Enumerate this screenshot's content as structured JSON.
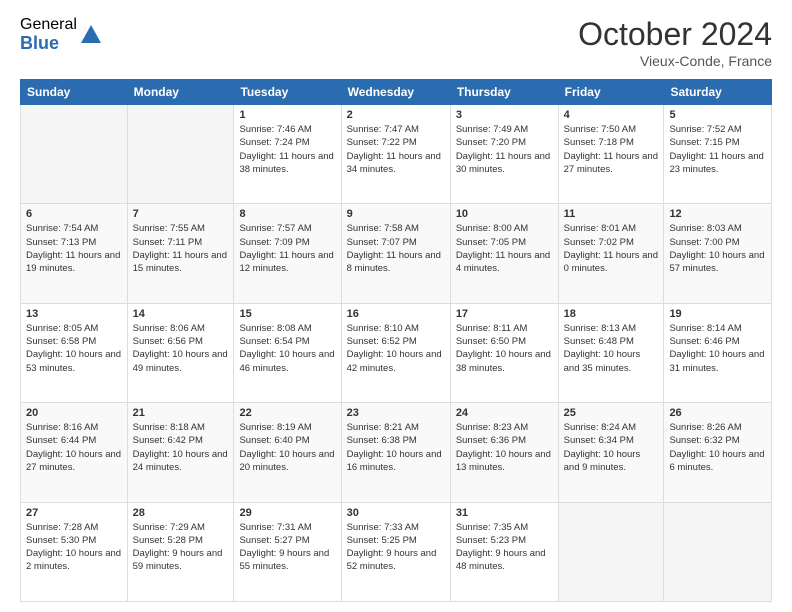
{
  "logo": {
    "general": "General",
    "blue": "Blue"
  },
  "title": {
    "month": "October 2024",
    "location": "Vieux-Conde, France"
  },
  "headers": [
    "Sunday",
    "Monday",
    "Tuesday",
    "Wednesday",
    "Thursday",
    "Friday",
    "Saturday"
  ],
  "weeks": [
    [
      {
        "day": "",
        "info": ""
      },
      {
        "day": "",
        "info": ""
      },
      {
        "day": "1",
        "info": "Sunrise: 7:46 AM\nSunset: 7:24 PM\nDaylight: 11 hours and 38 minutes."
      },
      {
        "day": "2",
        "info": "Sunrise: 7:47 AM\nSunset: 7:22 PM\nDaylight: 11 hours and 34 minutes."
      },
      {
        "day": "3",
        "info": "Sunrise: 7:49 AM\nSunset: 7:20 PM\nDaylight: 11 hours and 30 minutes."
      },
      {
        "day": "4",
        "info": "Sunrise: 7:50 AM\nSunset: 7:18 PM\nDaylight: 11 hours and 27 minutes."
      },
      {
        "day": "5",
        "info": "Sunrise: 7:52 AM\nSunset: 7:15 PM\nDaylight: 11 hours and 23 minutes."
      }
    ],
    [
      {
        "day": "6",
        "info": "Sunrise: 7:54 AM\nSunset: 7:13 PM\nDaylight: 11 hours and 19 minutes."
      },
      {
        "day": "7",
        "info": "Sunrise: 7:55 AM\nSunset: 7:11 PM\nDaylight: 11 hours and 15 minutes."
      },
      {
        "day": "8",
        "info": "Sunrise: 7:57 AM\nSunset: 7:09 PM\nDaylight: 11 hours and 12 minutes."
      },
      {
        "day": "9",
        "info": "Sunrise: 7:58 AM\nSunset: 7:07 PM\nDaylight: 11 hours and 8 minutes."
      },
      {
        "day": "10",
        "info": "Sunrise: 8:00 AM\nSunset: 7:05 PM\nDaylight: 11 hours and 4 minutes."
      },
      {
        "day": "11",
        "info": "Sunrise: 8:01 AM\nSunset: 7:02 PM\nDaylight: 11 hours and 0 minutes."
      },
      {
        "day": "12",
        "info": "Sunrise: 8:03 AM\nSunset: 7:00 PM\nDaylight: 10 hours and 57 minutes."
      }
    ],
    [
      {
        "day": "13",
        "info": "Sunrise: 8:05 AM\nSunset: 6:58 PM\nDaylight: 10 hours and 53 minutes."
      },
      {
        "day": "14",
        "info": "Sunrise: 8:06 AM\nSunset: 6:56 PM\nDaylight: 10 hours and 49 minutes."
      },
      {
        "day": "15",
        "info": "Sunrise: 8:08 AM\nSunset: 6:54 PM\nDaylight: 10 hours and 46 minutes."
      },
      {
        "day": "16",
        "info": "Sunrise: 8:10 AM\nSunset: 6:52 PM\nDaylight: 10 hours and 42 minutes."
      },
      {
        "day": "17",
        "info": "Sunrise: 8:11 AM\nSunset: 6:50 PM\nDaylight: 10 hours and 38 minutes."
      },
      {
        "day": "18",
        "info": "Sunrise: 8:13 AM\nSunset: 6:48 PM\nDaylight: 10 hours and 35 minutes."
      },
      {
        "day": "19",
        "info": "Sunrise: 8:14 AM\nSunset: 6:46 PM\nDaylight: 10 hours and 31 minutes."
      }
    ],
    [
      {
        "day": "20",
        "info": "Sunrise: 8:16 AM\nSunset: 6:44 PM\nDaylight: 10 hours and 27 minutes."
      },
      {
        "day": "21",
        "info": "Sunrise: 8:18 AM\nSunset: 6:42 PM\nDaylight: 10 hours and 24 minutes."
      },
      {
        "day": "22",
        "info": "Sunrise: 8:19 AM\nSunset: 6:40 PM\nDaylight: 10 hours and 20 minutes."
      },
      {
        "day": "23",
        "info": "Sunrise: 8:21 AM\nSunset: 6:38 PM\nDaylight: 10 hours and 16 minutes."
      },
      {
        "day": "24",
        "info": "Sunrise: 8:23 AM\nSunset: 6:36 PM\nDaylight: 10 hours and 13 minutes."
      },
      {
        "day": "25",
        "info": "Sunrise: 8:24 AM\nSunset: 6:34 PM\nDaylight: 10 hours and 9 minutes."
      },
      {
        "day": "26",
        "info": "Sunrise: 8:26 AM\nSunset: 6:32 PM\nDaylight: 10 hours and 6 minutes."
      }
    ],
    [
      {
        "day": "27",
        "info": "Sunrise: 7:28 AM\nSunset: 5:30 PM\nDaylight: 10 hours and 2 minutes."
      },
      {
        "day": "28",
        "info": "Sunrise: 7:29 AM\nSunset: 5:28 PM\nDaylight: 9 hours and 59 minutes."
      },
      {
        "day": "29",
        "info": "Sunrise: 7:31 AM\nSunset: 5:27 PM\nDaylight: 9 hours and 55 minutes."
      },
      {
        "day": "30",
        "info": "Sunrise: 7:33 AM\nSunset: 5:25 PM\nDaylight: 9 hours and 52 minutes."
      },
      {
        "day": "31",
        "info": "Sunrise: 7:35 AM\nSunset: 5:23 PM\nDaylight: 9 hours and 48 minutes."
      },
      {
        "day": "",
        "info": ""
      },
      {
        "day": "",
        "info": ""
      }
    ]
  ]
}
